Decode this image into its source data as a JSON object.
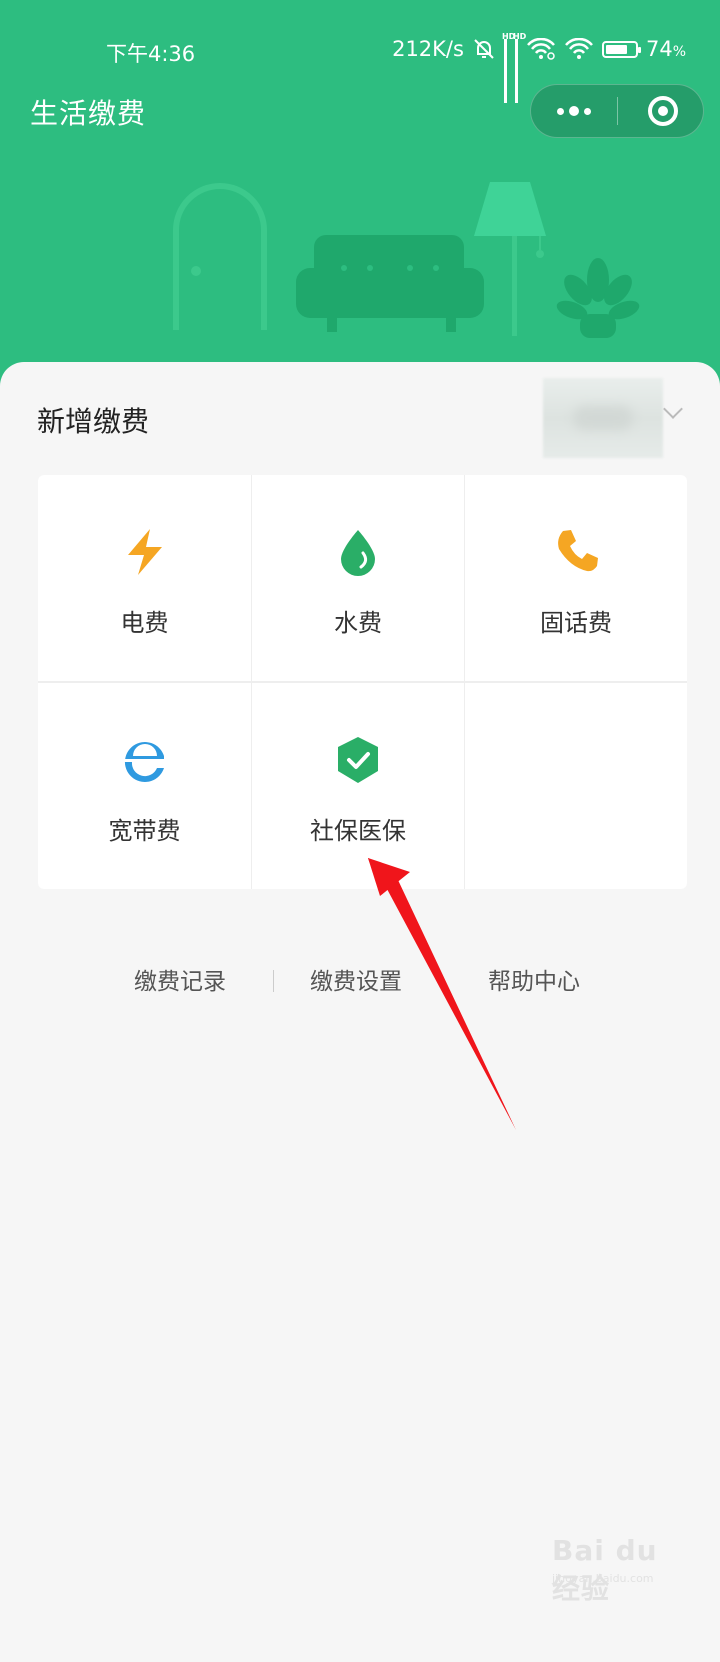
{
  "status_bar": {
    "time": "下午4:36",
    "net_speed": "212K/s",
    "battery": "74",
    "battery_unit": "%",
    "battery_level": 0.74,
    "hd_label": "HD"
  },
  "header": {
    "title": "生活缴费",
    "theme_color": "#2dbd80"
  },
  "section": {
    "title": "新增缴费"
  },
  "payment_items": [
    {
      "label": "电费",
      "icon": "lightning-icon",
      "color": "#f5a623"
    },
    {
      "label": "水费",
      "icon": "water-drop-icon",
      "color": "#2aae67"
    },
    {
      "label": "固话费",
      "icon": "phone-icon",
      "color": "#f5a623"
    },
    {
      "label": "宽带费",
      "icon": "broadband-e-icon",
      "color": "#2f9ae0"
    },
    {
      "label": "社保医保",
      "icon": "shield-check-icon",
      "color": "#2aae67"
    }
  ],
  "footer_links": {
    "records": "缴费记录",
    "settings": "缴费设置",
    "help": "帮助中心"
  },
  "watermark": {
    "text": "Bai du 经验",
    "sub": "jingyan.baidu.com"
  }
}
